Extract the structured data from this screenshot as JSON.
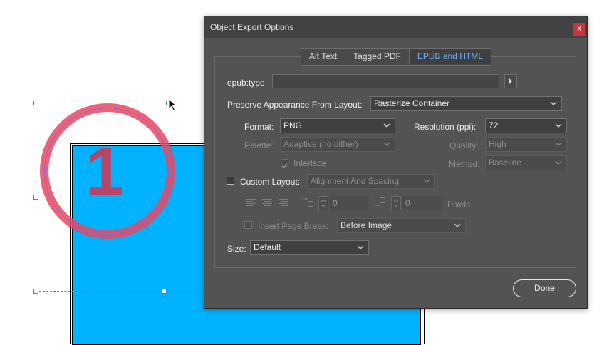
{
  "dialog": {
    "title": "Object Export Options",
    "close_label": "x",
    "tabs": [
      {
        "label": "Alt Text"
      },
      {
        "label": "Tagged PDF"
      },
      {
        "label": "EPUB and HTML"
      }
    ],
    "epub_type": {
      "label": "epub:type",
      "value": ""
    },
    "preserve": {
      "label": "Preserve Appearance From Layout:",
      "value": "Rasterize Container"
    },
    "format": {
      "label": "Format:",
      "value": "PNG"
    },
    "resolution": {
      "label": "Resolution (ppi):",
      "value": "72"
    },
    "palette": {
      "label": "Palette:",
      "value": "Adaptive (no dither)"
    },
    "quality": {
      "label": "Quality:",
      "value": "High"
    },
    "interlace": {
      "label": "Interlace",
      "checked": true
    },
    "method": {
      "label": "Method:",
      "value": "Baseline"
    },
    "custom_layout": {
      "label": "Custom Layout:",
      "checked": false,
      "value": "Alignment And Spacing"
    },
    "spacing_before": "0",
    "spacing_after": "0",
    "pixels_label": "Pixels",
    "page_break": {
      "label": "Insert Page Break:",
      "checked": false,
      "value": "Before Image"
    },
    "size": {
      "label": "Size:",
      "value": "Default"
    },
    "done_label": "Done"
  },
  "canvas": {
    "circle_number": "1"
  },
  "colors": {
    "accent_tab": "#6fb1ff",
    "canvas_fill": "#00b2ff",
    "circle": "#eb465f",
    "close": "#c8363b"
  }
}
